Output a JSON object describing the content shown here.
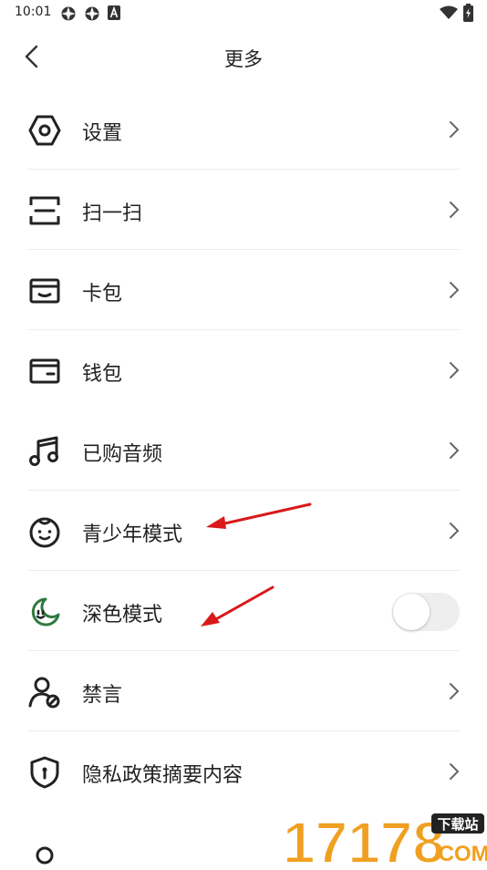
{
  "status_bar": {
    "time": "10:01",
    "icons": [
      "settings-status-icon",
      "settings-status-icon",
      "text-a-icon",
      "wifi-icon",
      "battery-icon"
    ]
  },
  "header": {
    "title": "更多",
    "back_icon": "chevron-left-icon"
  },
  "menu": {
    "items": [
      {
        "label": "设置",
        "icon": "hexagon-settings-icon",
        "control": "chevron"
      },
      {
        "label": "扫一扫",
        "icon": "scan-icon",
        "control": "chevron"
      },
      {
        "label": "卡包",
        "icon": "card-holder-icon",
        "control": "chevron"
      },
      {
        "label": "钱包",
        "icon": "wallet-icon",
        "control": "chevron"
      },
      {
        "label": "已购音频",
        "icon": "music-note-icon",
        "control": "chevron"
      },
      {
        "label": "青少年模式",
        "icon": "child-face-icon",
        "control": "chevron"
      },
      {
        "label": "深色模式",
        "icon": "moon-icon",
        "control": "toggle",
        "toggle_on": false
      },
      {
        "label": "禁言",
        "icon": "user-mute-icon",
        "control": "chevron"
      },
      {
        "label": "隐私政策摘要内容",
        "icon": "shield-keyhole-icon",
        "control": "chevron"
      }
    ]
  },
  "colors": {
    "background": "#ffffff",
    "text": "#222222",
    "divider": "#ececec",
    "chevron": "#666666",
    "toggle_track": "#eeeeee",
    "annotation_arrow": "#d9191b",
    "watermark_orange": "#f0a020"
  },
  "watermark": {
    "text": "17178",
    "badge": "下载站",
    "suffix": ".COM"
  }
}
